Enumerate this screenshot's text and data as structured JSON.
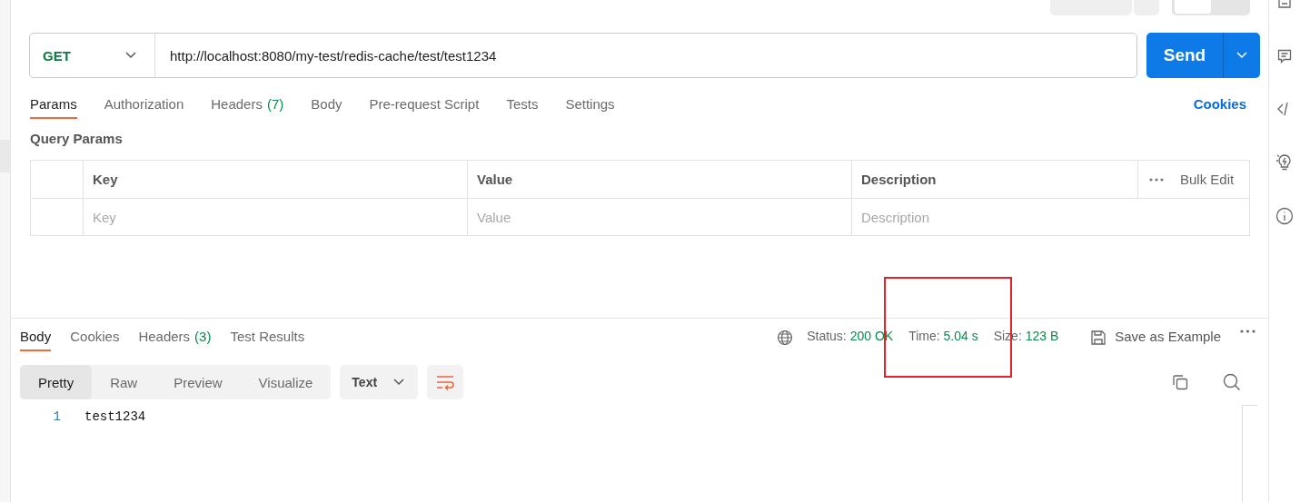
{
  "request": {
    "method": "GET",
    "url": "http://localhost:8080/my-test/redis-cache/test/test1234",
    "send_label": "Send"
  },
  "request_tabs": [
    {
      "label": "Params",
      "selected": true
    },
    {
      "label": "Authorization",
      "selected": false
    },
    {
      "label": "Headers",
      "count": "(7)",
      "selected": false
    },
    {
      "label": "Body",
      "selected": false
    },
    {
      "label": "Pre-request Script",
      "selected": false
    },
    {
      "label": "Tests",
      "selected": false
    },
    {
      "label": "Settings",
      "selected": false
    }
  ],
  "cookies_link": "Cookies",
  "query_params": {
    "title": "Query Params",
    "columns": [
      "Key",
      "Value",
      "Description"
    ],
    "bulk_edit": "Bulk Edit",
    "placeholders": [
      "Key",
      "Value",
      "Description"
    ]
  },
  "response_tabs": [
    {
      "label": "Body",
      "selected": true
    },
    {
      "label": "Cookies",
      "selected": false
    },
    {
      "label": "Headers",
      "count": "(3)",
      "selected": false
    },
    {
      "label": "Test Results",
      "selected": false
    }
  ],
  "response_meta": [
    {
      "label": "Status:",
      "value": "200 OK"
    },
    {
      "label": "Time:",
      "value": "5.04 s"
    },
    {
      "label": "Size:",
      "value": "123 B"
    }
  ],
  "save_example": "Save as Example",
  "view_modes": [
    {
      "label": "Pretty",
      "selected": true
    },
    {
      "label": "Raw",
      "selected": false
    },
    {
      "label": "Preview",
      "selected": false
    },
    {
      "label": "Visualize",
      "selected": false
    }
  ],
  "format": "Text",
  "body_lines": [
    {
      "number": "1",
      "text": "test1234"
    }
  ]
}
